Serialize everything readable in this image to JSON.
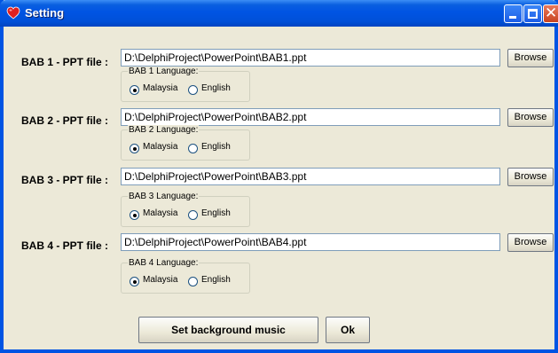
{
  "window": {
    "title": "Setting"
  },
  "bab": [
    {
      "label": "BAB 1 - PPT file  :",
      "path": "D:\\DelphiProject\\PowerPoint\\BAB1.ppt",
      "browse": "Browse",
      "group_label": "BAB 1 Language:",
      "opt1": "Malaysia",
      "opt2": "English",
      "selected": "Malaysia"
    },
    {
      "label": "BAB 2 - PPT file  :",
      "path": "D:\\DelphiProject\\PowerPoint\\BAB2.ppt",
      "browse": "Browse",
      "group_label": "BAB 2 Language:",
      "opt1": "Malaysia",
      "opt2": "English",
      "selected": "Malaysia"
    },
    {
      "label": "BAB 3 - PPT file  :",
      "path": "D:\\DelphiProject\\PowerPoint\\BAB3.ppt",
      "browse": "Browse",
      "group_label": "BAB 3 Language:",
      "opt1": "Malaysia",
      "opt2": "English",
      "selected": "Malaysia"
    },
    {
      "label": "BAB 4 - PPT file  :",
      "path": "D:\\DelphiProject\\PowerPoint\\BAB4.ppt",
      "browse": "Browse",
      "group_label": "BAB 4 Language:",
      "opt1": "Malaysia",
      "opt2": "English",
      "selected": "Malaysia"
    }
  ],
  "buttons": {
    "music": "Set background music",
    "ok": "Ok"
  },
  "colors": {
    "titlebar": "#0054e3",
    "face": "#ece9d8",
    "close": "#c8431f"
  }
}
